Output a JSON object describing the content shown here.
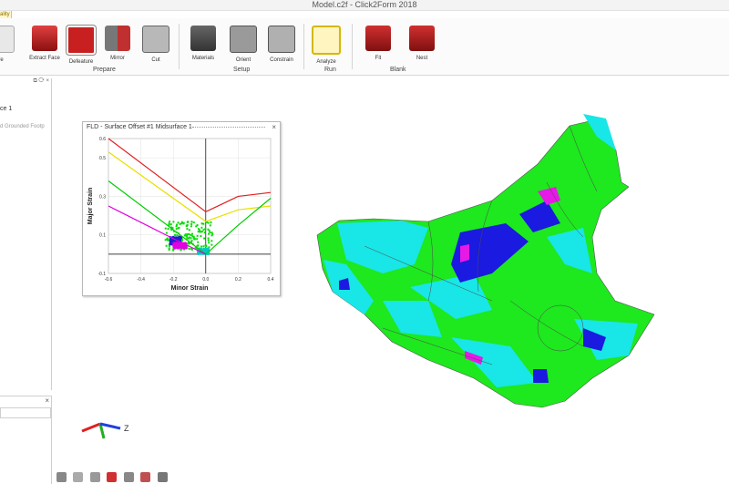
{
  "window": {
    "title": "Model.c2f - Click2Form 2018"
  },
  "ribbon": {
    "active_tab": "ality",
    "buttons": [
      {
        "label": "re",
        "icon": "geometry-icon"
      },
      {
        "label": "Extract Face",
        "icon": "extract-face-icon"
      },
      {
        "label": "Defeature",
        "icon": "defeature-icon"
      },
      {
        "label": "Mirror",
        "icon": "mirror-icon"
      },
      {
        "label": "Cut",
        "icon": "cut-icon"
      },
      {
        "label": "Materials",
        "icon": "materials-icon"
      },
      {
        "label": "Orient",
        "icon": "orient-icon"
      },
      {
        "label": "Constrain",
        "icon": "constrain-icon"
      },
      {
        "label": "Analyze",
        "icon": "analyze-icon"
      },
      {
        "label": "Fit",
        "icon": "fit-blank-icon"
      },
      {
        "label": "Nest",
        "icon": "nest-icon"
      }
    ],
    "groups": {
      "prepare": "Prepare",
      "setup": "Setup",
      "run": "Run",
      "blank": "Blank"
    }
  },
  "left_panel": {
    "header_icons": "⧉ ⟳ ×",
    "item1": "ce 1",
    "item2": "d Grounded Footp",
    "close2": "×"
  },
  "fld_window": {
    "title": "FLD - Surface Offset #1 Midsurface 1",
    "close": "×"
  },
  "chart_data": {
    "type": "scatter",
    "title": "",
    "xlabel": "Minor Strain",
    "ylabel": "Major Strain",
    "xlim": [
      -0.6,
      0.4
    ],
    "ylim": [
      -0.1,
      0.6
    ],
    "xticks": [
      "-0.6",
      "-0.4",
      "-0.2",
      "0.0",
      "0.2",
      "0.4"
    ],
    "yticks": [
      "-0.1",
      "0.1",
      "0.3",
      "0.5",
      "0.6"
    ],
    "grid": true,
    "curves": [
      {
        "color": "#e02020",
        "points": [
          [
            -0.6,
            0.6
          ],
          [
            0.0,
            0.22
          ],
          [
            0.1,
            0.26
          ],
          [
            0.2,
            0.3
          ],
          [
            0.3,
            0.31
          ],
          [
            0.4,
            0.32
          ]
        ]
      },
      {
        "color": "#e8e000",
        "points": [
          [
            -0.6,
            0.53
          ],
          [
            0.0,
            0.17
          ],
          [
            0.1,
            0.2
          ],
          [
            0.2,
            0.23
          ],
          [
            0.3,
            0.24
          ],
          [
            0.4,
            0.25
          ]
        ]
      },
      {
        "color": "#00cc00",
        "points": [
          [
            -0.6,
            0.38
          ],
          [
            0.0,
            0.0
          ],
          [
            0.2,
            0.15
          ],
          [
            0.4,
            0.29
          ]
        ]
      },
      {
        "color": "#e000e0",
        "points": [
          [
            -0.6,
            0.25
          ],
          [
            -0.2,
            0.08
          ],
          [
            0.0,
            0.0
          ]
        ]
      }
    ],
    "scatter_regions": [
      {
        "color": "#00dd00",
        "x": [
          -0.25,
          0.05
        ],
        "y": [
          0.02,
          0.17
        ]
      },
      {
        "color": "#1f1fd0",
        "x": [
          -0.22,
          -0.15
        ],
        "y": [
          0.05,
          0.09
        ]
      },
      {
        "color": "#e000e0",
        "x": [
          -0.2,
          -0.12
        ],
        "y": [
          0.03,
          0.06
        ]
      },
      {
        "color": "#00c8c8",
        "x": [
          -0.05,
          0.02
        ],
        "y": [
          0.0,
          0.03
        ]
      }
    ]
  },
  "colors": {
    "green": "#1ee81e",
    "cyan": "#19e6e6",
    "blue": "#1a1ae0",
    "magenta": "#e619e6",
    "triad_x": "#e02020",
    "triad_y": "#20b020",
    "triad_z": "#2040e0"
  },
  "triad": {
    "z_label": "Z"
  },
  "view_toolbar": [
    "view-shaded-icon",
    "view-fit-icon",
    "view-section-icon",
    "view-red-icon",
    "view-zoom-icon",
    "view-color-icon",
    "view-cube-icon"
  ]
}
